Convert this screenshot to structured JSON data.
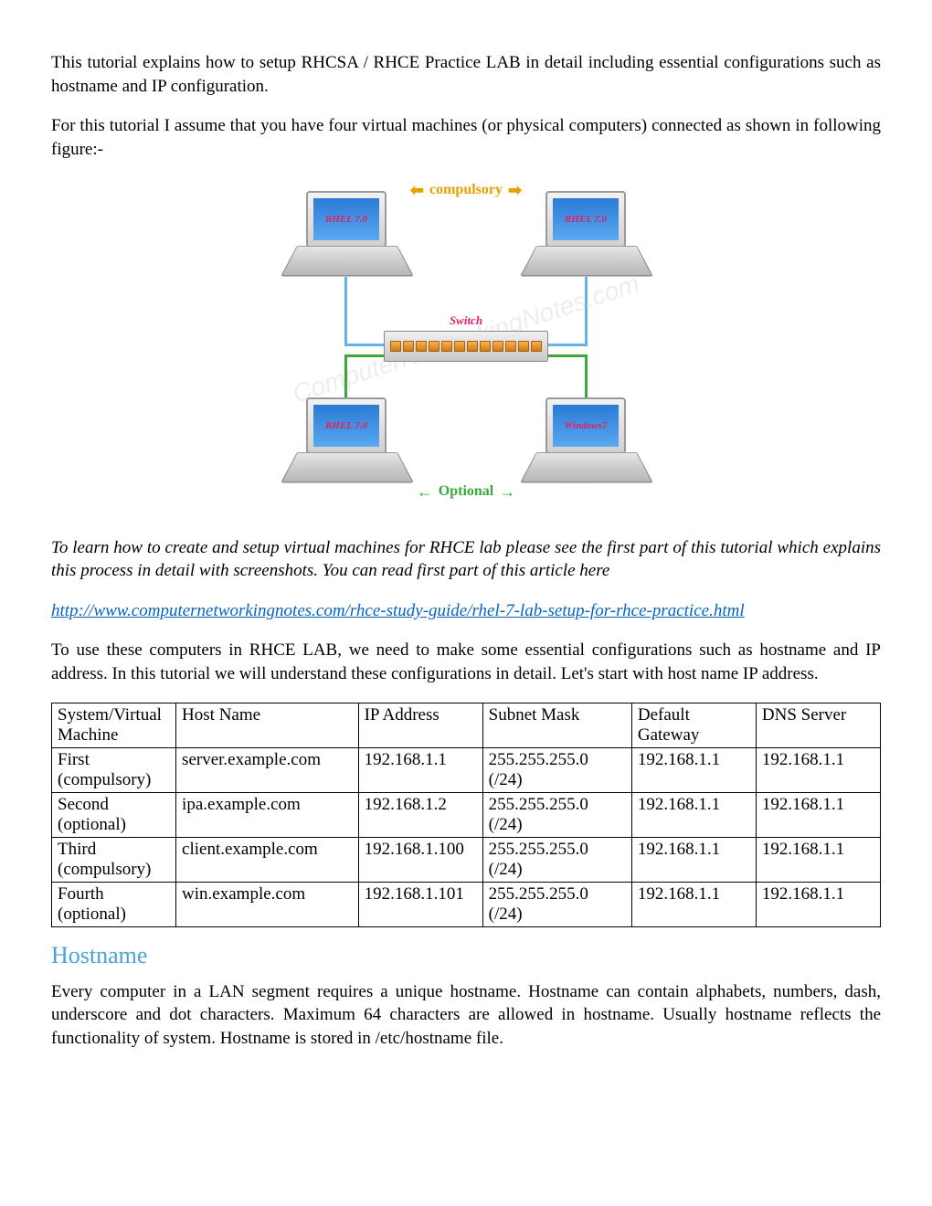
{
  "paragraphs": {
    "intro1": "This tutorial explains how to setup RHCSA / RHCE Practice LAB in detail including essential configurations such as hostname and IP configuration.",
    "intro2": "For this tutorial I assume that you have four virtual machines (or physical computers) connected as shown in following figure:-",
    "italic_note": "To learn how to create and setup virtual machines for RHCE lab please see the first part of this tutorial which explains this process in detail with screenshots. You can read first part of this article here",
    "after_link": "To use these computers in RHCE LAB, we need to make some essential configurations such as hostname and IP address. In this tutorial we will understand these configurations in detail. Let's start with host name IP address.",
    "hostname_body": "Every computer in a LAN segment requires a unique hostname. Hostname can contain alphabets, numbers, dash, underscore and dot characters. Maximum 64 characters are allowed in hostname. Usually hostname reflects the functionality of system.  Hostname is stored in /etc/hostname file."
  },
  "link_text": "http://www.computernetworkingnotes.com/rhce-study-guide/rhel-7-lab-setup-for-rhce-practice.html",
  "diagram": {
    "top_label": "compulsory",
    "bottom_label": "Optional",
    "switch_label": "Switch",
    "watermark": "ComputerNetworkingNotes.com",
    "nodes": {
      "tl": "RHEL 7.0",
      "tr": "RHEL 7.0",
      "bl": "RHEL 7.0",
      "br": "Windows7"
    }
  },
  "table": {
    "headers": [
      "System/Virtual Machine",
      "Host Name",
      "IP Address",
      "Subnet Mask",
      "Default Gateway",
      "DNS Server"
    ],
    "rows": [
      [
        "First (compulsory)",
        "server.example.com",
        "192.168.1.1",
        "255.255.255.0 (/24)",
        "192.168.1.1",
        "192.168.1.1"
      ],
      [
        "Second (optional)",
        "ipa.example.com",
        "192.168.1.2",
        "255.255.255.0 (/24)",
        "192.168.1.1",
        "192.168.1.1"
      ],
      [
        "Third (compulsory)",
        "client.example.com",
        "192.168.1.100",
        "255.255.255.0 (/24)",
        "192.168.1.1",
        "192.168.1.1"
      ],
      [
        "Fourth (optional)",
        "win.example.com",
        "192.168.1.101",
        "255.255.255.0 (/24)",
        "192.168.1.1",
        "192.168.1.1"
      ]
    ]
  },
  "heading_hostname": "Hostname",
  "arrows": {
    "left": "⬅",
    "right": "➡",
    "left_g": "←",
    "right_g": "→"
  }
}
